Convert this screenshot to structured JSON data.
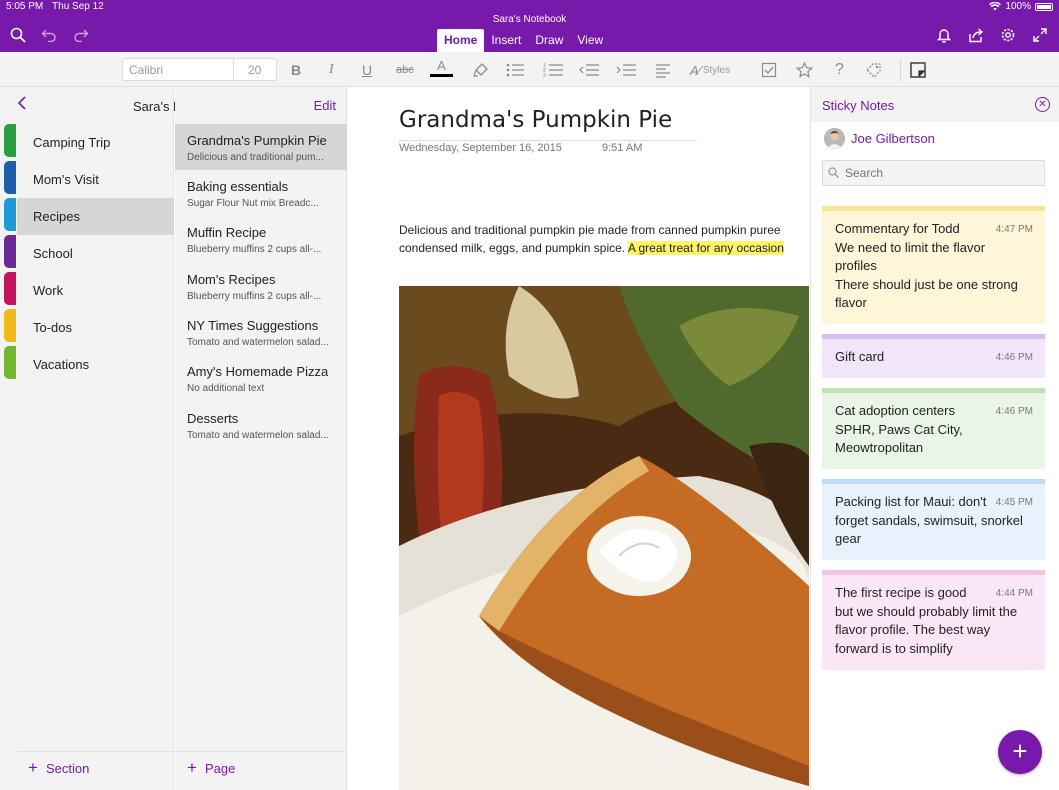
{
  "status_bar": {
    "time": "5:05 PM",
    "date": "Thu Sep 12",
    "battery": "100%"
  },
  "app": {
    "notebook_title": "Sara's Notebook"
  },
  "tabs": [
    {
      "label": "Home",
      "active": true
    },
    {
      "label": "Insert",
      "active": false
    },
    {
      "label": "Draw",
      "active": false
    },
    {
      "label": "View",
      "active": false
    }
  ],
  "ribbon": {
    "font_name": "Calibri",
    "font_size": "20",
    "styles_label": "Styles"
  },
  "sections_panel": {
    "notebook_name": "Sara's Notebook",
    "edit_label": "Edit",
    "sections": [
      {
        "label": "Camping Trip",
        "color": "#2e9e42"
      },
      {
        "label": "Mom's Visit",
        "color": "#1f5fa8"
      },
      {
        "label": "Recipes",
        "color": "#1e9ad6"
      },
      {
        "label": "School",
        "color": "#6a2a9a"
      },
      {
        "label": "Work",
        "color": "#c3135f"
      },
      {
        "label": "To-dos",
        "color": "#f0b91c"
      },
      {
        "label": "Vacations",
        "color": "#74b72e"
      }
    ],
    "selected_section": "Recipes",
    "add_label": "Section"
  },
  "pages_panel": {
    "pages": [
      {
        "title": "Grandma's Pumpkin Pie",
        "preview": "Delicious and traditional pum..."
      },
      {
        "title": "Baking essentials",
        "preview": "Sugar  Flour  Nut mix  Breadc..."
      },
      {
        "title": "Muffin Recipe",
        "preview": "Blueberry muffins  2 cups all-..."
      },
      {
        "title": "Mom's Recipes",
        "preview": "Blueberry muffins  2 cups all-..."
      },
      {
        "title": "NY Times Suggestions",
        "preview": "Tomato and watermelon salad..."
      },
      {
        "title": "Amy's Homemade Pizza",
        "preview": "No additional text"
      },
      {
        "title": "Desserts",
        "preview": "Tomato and watermelon salad..."
      }
    ],
    "add_label": "Page"
  },
  "page": {
    "title": "Grandma's Pumpkin Pie",
    "date": "Wednesday, September 16, 2015",
    "time": "9:51 AM",
    "body_line1": "Delicious and traditional pumpkin pie made from canned pumpkin puree",
    "body_line2_plain": "condensed milk, eggs, and pumpkin spice.",
    "body_line2_highlight": "A great treat for any occasion"
  },
  "sticky_notes": {
    "title": "Sticky Notes",
    "user_name": "Joe Gilbertson",
    "search_placeholder": "Search",
    "notes": [
      {
        "time": "4:47 PM",
        "lines": [
          "Commentary for Todd",
          "We need to limit the flavor",
          "profiles",
          "There should just be one strong",
          "flavor"
        ],
        "bg": "#fff5d9",
        "bar": "#f9e59a"
      },
      {
        "time": "4:46 PM",
        "lines": [
          "Gift card"
        ],
        "bg": "#f1e5fa",
        "bar": "#d8bff0"
      },
      {
        "time": "4:46 PM",
        "lines": [
          "Cat adoption centers",
          "SPHR, Paws Cat City,",
          "Meowtropolitan"
        ],
        "bg": "#e9f5e6",
        "bar": "#bfe3b3"
      },
      {
        "time": "4:45 PM",
        "lines": [
          "Packing list for Maui: don't",
          "forget sandals, swimsuit, snorkel",
          "gear"
        ],
        "bg": "#e7f2fc",
        "bar": "#bcdcf6"
      },
      {
        "time": "4:44 PM",
        "lines": [
          "The first recipe is good",
          "but we should probably limit the",
          "flavor profile. The best way",
          "forward is to simplify"
        ],
        "bg": "#fbe6f5",
        "bar": "#f2c3e6"
      }
    ]
  },
  "colors": {
    "accent": "#7719aa",
    "highlight": "#fff564"
  }
}
